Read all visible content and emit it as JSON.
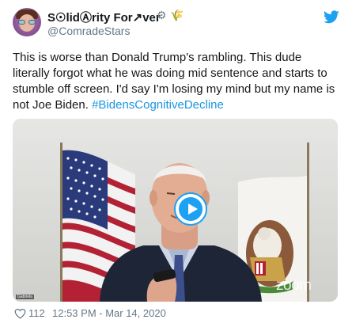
{
  "author": {
    "display_name": "S☉lidⒶrity For↗ver",
    "display_name_emojis": [
      "⚙",
      "🌾"
    ],
    "handle": "@ComradeStars"
  },
  "tweet": {
    "text": "This is worse than Donald Trump's rambling. This dude literally forgot what he was doing mid sentence and starts to stumble off screen. I'd say I'm losing my mind but my name is not Joe Biden. ",
    "hashtag": "#BidensCognitiveDecline"
  },
  "media": {
    "watermark": "zoom",
    "caption": "Gabriela"
  },
  "footer": {
    "like_count": "112",
    "timestamp": "12:53 PM - Mar 14, 2020"
  },
  "colors": {
    "accent": "#1da1f2",
    "hashtag": "#1b95e0",
    "muted": "#657786",
    "text": "#14171a"
  },
  "icons": {
    "brand": "twitter-bird-icon",
    "like": "heart-icon",
    "play": "play-icon"
  }
}
